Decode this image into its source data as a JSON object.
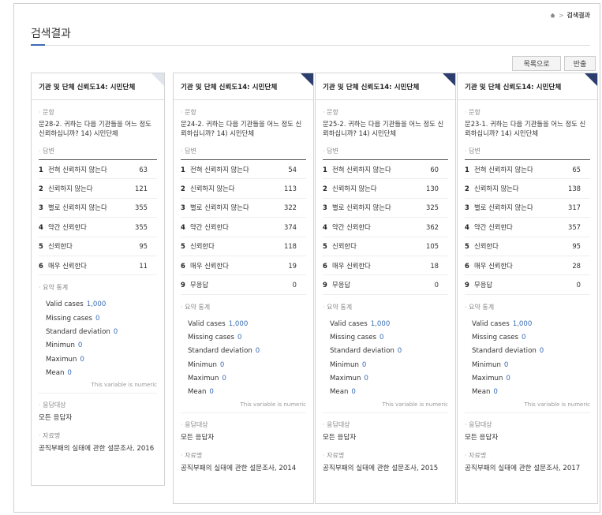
{
  "breadcrumb": {
    "current": "검색결과",
    "separator": ">"
  },
  "page": {
    "title": "검색결과"
  },
  "toolbar": {
    "list_label": "목록으로",
    "return_label": "반출"
  },
  "labels": {
    "question": "문항",
    "answers": "답변",
    "summary": "요약 통계",
    "target": "응답대상",
    "source": "자료명",
    "numeric_note": "This variable is numeric"
  },
  "cards": [
    {
      "title": "기관 및 단체 신뢰도14: 시민단체",
      "question": "문28-2. 귀하는 다음 기관들을 어느 정도 신뢰하십니까? 14) 시민단체",
      "answers": [
        {
          "num": "1",
          "label": "전혀 신뢰하지 않는다",
          "count": "63"
        },
        {
          "num": "2",
          "label": "신뢰하지 않는다",
          "count": "121"
        },
        {
          "num": "3",
          "label": "별로 신뢰하지 않는다",
          "count": "355"
        },
        {
          "num": "4",
          "label": "약간 신뢰한다",
          "count": "355"
        },
        {
          "num": "5",
          "label": "신뢰한다",
          "count": "95"
        },
        {
          "num": "6",
          "label": "매우 신뢰한다",
          "count": "11"
        }
      ],
      "stats": [
        {
          "label": "Valid cases",
          "value": "1,000"
        },
        {
          "label": "Missing cases",
          "value": "0"
        },
        {
          "label": "Standard deviation",
          "value": "0"
        },
        {
          "label": "Minimun",
          "value": "0"
        },
        {
          "label": "Maximun",
          "value": "0"
        },
        {
          "label": "Mean",
          "value": "0"
        }
      ],
      "target": "모든 응답자",
      "source": "공직부패의 실태에 관한 설문조사, 2016",
      "corner_color": "#dfe3ea"
    },
    {
      "title": "기관 및 단체 신뢰도14: 시민단체",
      "question": "문24-2. 귀하는 다음 기관들을 어느 정도 신뢰하십니까? 14) 시민단체",
      "answers": [
        {
          "num": "1",
          "label": "전혀 신뢰하지 않는다",
          "count": "54"
        },
        {
          "num": "2",
          "label": "신뢰하지 않는다",
          "count": "113"
        },
        {
          "num": "3",
          "label": "별로 신뢰하지 않는다",
          "count": "322"
        },
        {
          "num": "4",
          "label": "약간 신뢰한다",
          "count": "374"
        },
        {
          "num": "5",
          "label": "신뢰한다",
          "count": "118"
        },
        {
          "num": "6",
          "label": "매우 신뢰한다",
          "count": "19"
        },
        {
          "num": "9",
          "label": "무응답",
          "count": "0"
        }
      ],
      "stats": [
        {
          "label": "Valid cases",
          "value": "1,000"
        },
        {
          "label": "Missing cases",
          "value": "0"
        },
        {
          "label": "Standard deviation",
          "value": "0"
        },
        {
          "label": "Minimun",
          "value": "0"
        },
        {
          "label": "Maximun",
          "value": "0"
        },
        {
          "label": "Mean",
          "value": "0"
        }
      ],
      "target": "모든 응답자",
      "source": "공직부패의 실태에 관한 설문조사, 2014",
      "corner_color": "#2c3e6e"
    },
    {
      "title": "기관 및 단체 신뢰도14: 시민단체",
      "question": "문25-2. 귀하는 다음 기관들을 어느 정도 신뢰하십니까? 14) 시민단체",
      "answers": [
        {
          "num": "1",
          "label": "전혀 신뢰하지 않는다",
          "count": "60"
        },
        {
          "num": "2",
          "label": "신뢰하지 않는다",
          "count": "130"
        },
        {
          "num": "3",
          "label": "별로 신뢰하지 않는다",
          "count": "325"
        },
        {
          "num": "4",
          "label": "약간 신뢰한다",
          "count": "362"
        },
        {
          "num": "5",
          "label": "신뢰한다",
          "count": "105"
        },
        {
          "num": "6",
          "label": "매우 신뢰한다",
          "count": "18"
        },
        {
          "num": "9",
          "label": "무응답",
          "count": "0"
        }
      ],
      "stats": [
        {
          "label": "Valid cases",
          "value": "1,000"
        },
        {
          "label": "Missing cases",
          "value": "0"
        },
        {
          "label": "Standard deviation",
          "value": "0"
        },
        {
          "label": "Minimun",
          "value": "0"
        },
        {
          "label": "Maximun",
          "value": "0"
        },
        {
          "label": "Mean",
          "value": "0"
        }
      ],
      "target": "모든 응답자",
      "source": "공직부패의 실태에 관한 설문조사, 2015",
      "corner_color": "#2c3e6e"
    },
    {
      "title": "기관 및 단체 신뢰도14: 시민단체",
      "question": "문23-1. 귀하는 다음 기관들을 어느 정도 신뢰하십니까? 14) 시민단체",
      "answers": [
        {
          "num": "1",
          "label": "전혀 신뢰하지 않는다",
          "count": "65"
        },
        {
          "num": "2",
          "label": "신뢰하지 않는다",
          "count": "138"
        },
        {
          "num": "3",
          "label": "별로 신뢰하지 않는다",
          "count": "317"
        },
        {
          "num": "4",
          "label": "약간 신뢰한다",
          "count": "357"
        },
        {
          "num": "5",
          "label": "신뢰한다",
          "count": "95"
        },
        {
          "num": "6",
          "label": "매우 신뢰한다",
          "count": "28"
        },
        {
          "num": "9",
          "label": "무응답",
          "count": "0"
        }
      ],
      "stats": [
        {
          "label": "Valid cases",
          "value": "1,000"
        },
        {
          "label": "Missing cases",
          "value": "0"
        },
        {
          "label": "Standard deviation",
          "value": "0"
        },
        {
          "label": "Minimun",
          "value": "0"
        },
        {
          "label": "Maximun",
          "value": "0"
        },
        {
          "label": "Mean",
          "value": "0"
        }
      ],
      "target": "모든 응답자",
      "source": "공직부패의 실태에 관한 설문조사, 2017",
      "corner_color": "#2c3e6e"
    }
  ]
}
